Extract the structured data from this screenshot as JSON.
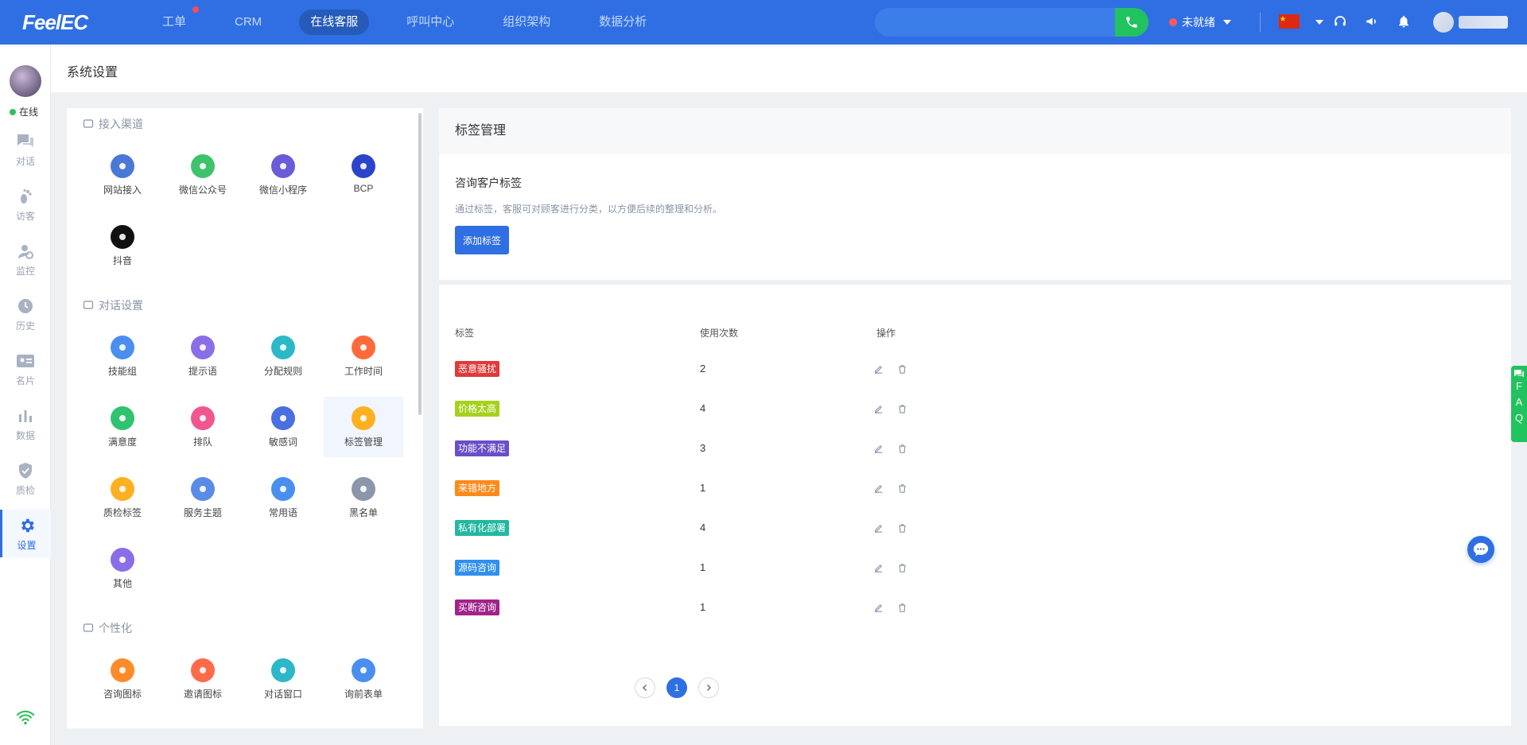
{
  "app": {
    "logo": "FeelEC"
  },
  "topnav": [
    {
      "label": "工单",
      "badge": true
    },
    {
      "label": "CRM"
    },
    {
      "label": "在线客服",
      "active": true
    },
    {
      "label": "呼叫中心"
    },
    {
      "label": "组织架构"
    },
    {
      "label": "数据分析"
    }
  ],
  "search": {
    "placeholder": "",
    "value": ""
  },
  "agent_status": {
    "label": "未就绪",
    "color": "#ff5a5a"
  },
  "sidebar": {
    "online_label": "在线",
    "items": [
      {
        "label": "对话",
        "icon": "chat-icon"
      },
      {
        "label": "访客",
        "icon": "footprint-icon"
      },
      {
        "label": "监控",
        "icon": "monitor-icon"
      },
      {
        "label": "历史",
        "icon": "clock-icon"
      },
      {
        "label": "名片",
        "icon": "card-icon"
      },
      {
        "label": "数据",
        "icon": "bar-chart-icon"
      },
      {
        "label": "质检",
        "icon": "shield-icon"
      },
      {
        "label": "设置",
        "icon": "gear-icon",
        "active": true
      }
    ]
  },
  "breadcrumb": "系统设置",
  "settings": {
    "sections": [
      {
        "title": "接入渠道",
        "items": [
          {
            "label": "网站接入",
            "color": "#4a78d6"
          },
          {
            "label": "微信公众号",
            "color": "#3dc36b"
          },
          {
            "label": "微信小程序",
            "color": "#6a5bd9"
          },
          {
            "label": "BCP",
            "color": "#2b44c9"
          },
          {
            "label": "抖音",
            "color": "#111111"
          }
        ]
      },
      {
        "title": "对话设置",
        "items": [
          {
            "label": "技能组",
            "color": "#4a8ff0"
          },
          {
            "label": "提示语",
            "color": "#8a6ee8"
          },
          {
            "label": "分配规则",
            "color": "#2cb8c8"
          },
          {
            "label": "工作时间",
            "color": "#ff6a3c"
          },
          {
            "label": "满意度",
            "color": "#2fc36f"
          },
          {
            "label": "排队",
            "color": "#f0578f"
          },
          {
            "label": "敏感词",
            "color": "#4a6fe0"
          },
          {
            "label": "标签管理",
            "color": "#ffb020",
            "active": true
          },
          {
            "label": "质检标签",
            "color": "#ffb020"
          },
          {
            "label": "服务主题",
            "color": "#5b8be8"
          },
          {
            "label": "常用语",
            "color": "#4a8ff0"
          },
          {
            "label": "黑名单",
            "color": "#8a96aa"
          },
          {
            "label": "其他",
            "color": "#8a6ee8"
          }
        ]
      },
      {
        "title": "个性化",
        "items": [
          {
            "label": "咨询图标",
            "color": "#ff8a2a"
          },
          {
            "label": "邀请图标",
            "color": "#ff6a4a"
          },
          {
            "label": "对话窗口",
            "color": "#2cb8c8"
          },
          {
            "label": "询前表单",
            "color": "#4a8ff0"
          }
        ]
      }
    ]
  },
  "tag_page": {
    "title": "标签管理",
    "subtitle": "咨询客户标签",
    "description": "通过标签，客服可对顾客进行分类，以方便后续的整理和分析。",
    "add_button": "添加标签",
    "columns": [
      "标签",
      "使用次数",
      "操作"
    ],
    "rows": [
      {
        "tag": "恶意骚扰",
        "color": "#e03a3a",
        "count": "2"
      },
      {
        "tag": "价格太高",
        "color": "#a5d11c",
        "count": "4"
      },
      {
        "tag": "功能不满足",
        "color": "#6a4fc8",
        "count": "3"
      },
      {
        "tag": "来错地方",
        "color": "#ff8a1a",
        "count": "1"
      },
      {
        "tag": "私有化部署",
        "color": "#22b8a0",
        "count": "4"
      },
      {
        "tag": "源码咨询",
        "color": "#2f8ff0",
        "count": "1"
      },
      {
        "tag": "买断咨询",
        "color": "#a0248a",
        "count": "1"
      }
    ],
    "pagination": {
      "current": "1"
    }
  },
  "faq": [
    "F",
    "A",
    "Q"
  ]
}
